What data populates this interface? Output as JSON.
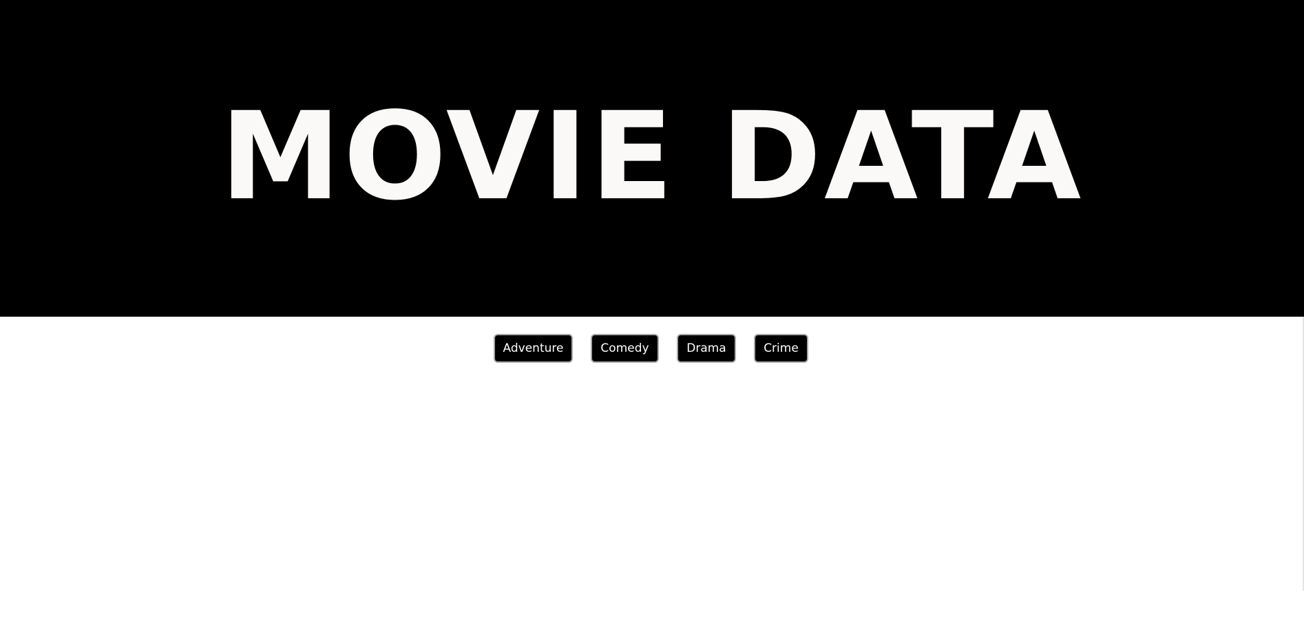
{
  "hero": {
    "title": "MOVIE DATA"
  },
  "genres": {
    "buttons": [
      "Adventure",
      "Comedy",
      "Drama",
      "Crime"
    ]
  },
  "colors": {
    "hero_background": "#000000",
    "hero_text": "#fbf9f7",
    "button_background": "#000000",
    "button_text": "#ffffff",
    "button_border": "#a9a9a9",
    "page_background": "#ffffff"
  }
}
